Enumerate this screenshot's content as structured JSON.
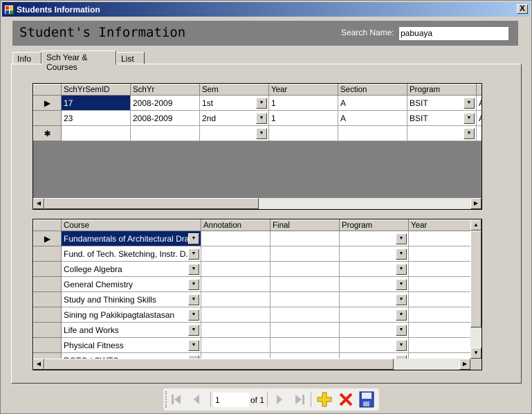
{
  "window": {
    "title": "Students Information",
    "close_label": "X"
  },
  "header": {
    "title": "Student's Information",
    "search_label": "Search Name:",
    "search_value": "pabuaya"
  },
  "tabs": [
    {
      "label": "Info"
    },
    {
      "label": "Sch Year & Courses",
      "active": true
    },
    {
      "label": "List"
    }
  ],
  "sem_grid": {
    "columns": [
      "SchYrSemID",
      "SchYr",
      "Sem",
      "Year",
      "Section",
      "Program",
      ""
    ],
    "rows": [
      {
        "SchYrSemID": "17",
        "SchYr": "2008-2009",
        "Sem": "1st",
        "Year": "1",
        "Section": "A",
        "Program": "BSIT",
        "next": "A",
        "current": true
      },
      {
        "SchYrSemID": "23",
        "SchYr": "2008-2009",
        "Sem": "2nd",
        "Year": "1",
        "Section": "A",
        "Program": "BSIT",
        "next": "A"
      }
    ],
    "new_row_marker": "✱"
  },
  "course_grid": {
    "columns": [
      "Course",
      "Annotation",
      "Final",
      "Program",
      "Year"
    ],
    "rows": [
      {
        "Course": "Fundamentals of Architectural Draf...",
        "current": true
      },
      {
        "Course": "Fund. of Tech. Sketching, Instr. D..."
      },
      {
        "Course": "College Algebra"
      },
      {
        "Course": "General Chemistry"
      },
      {
        "Course": "Study and Thinking Skills"
      },
      {
        "Course": "Sining ng Pakikipagtalastasan"
      },
      {
        "Course": "Life and Works"
      },
      {
        "Course": "Physical Fitness"
      },
      {
        "Course": "ROTC / CWTS"
      }
    ]
  },
  "navigator": {
    "position": "1",
    "count_label": "of 1",
    "buttons": [
      "move-first",
      "move-previous",
      "move-next",
      "move-last",
      "add-new",
      "delete",
      "save"
    ]
  }
}
